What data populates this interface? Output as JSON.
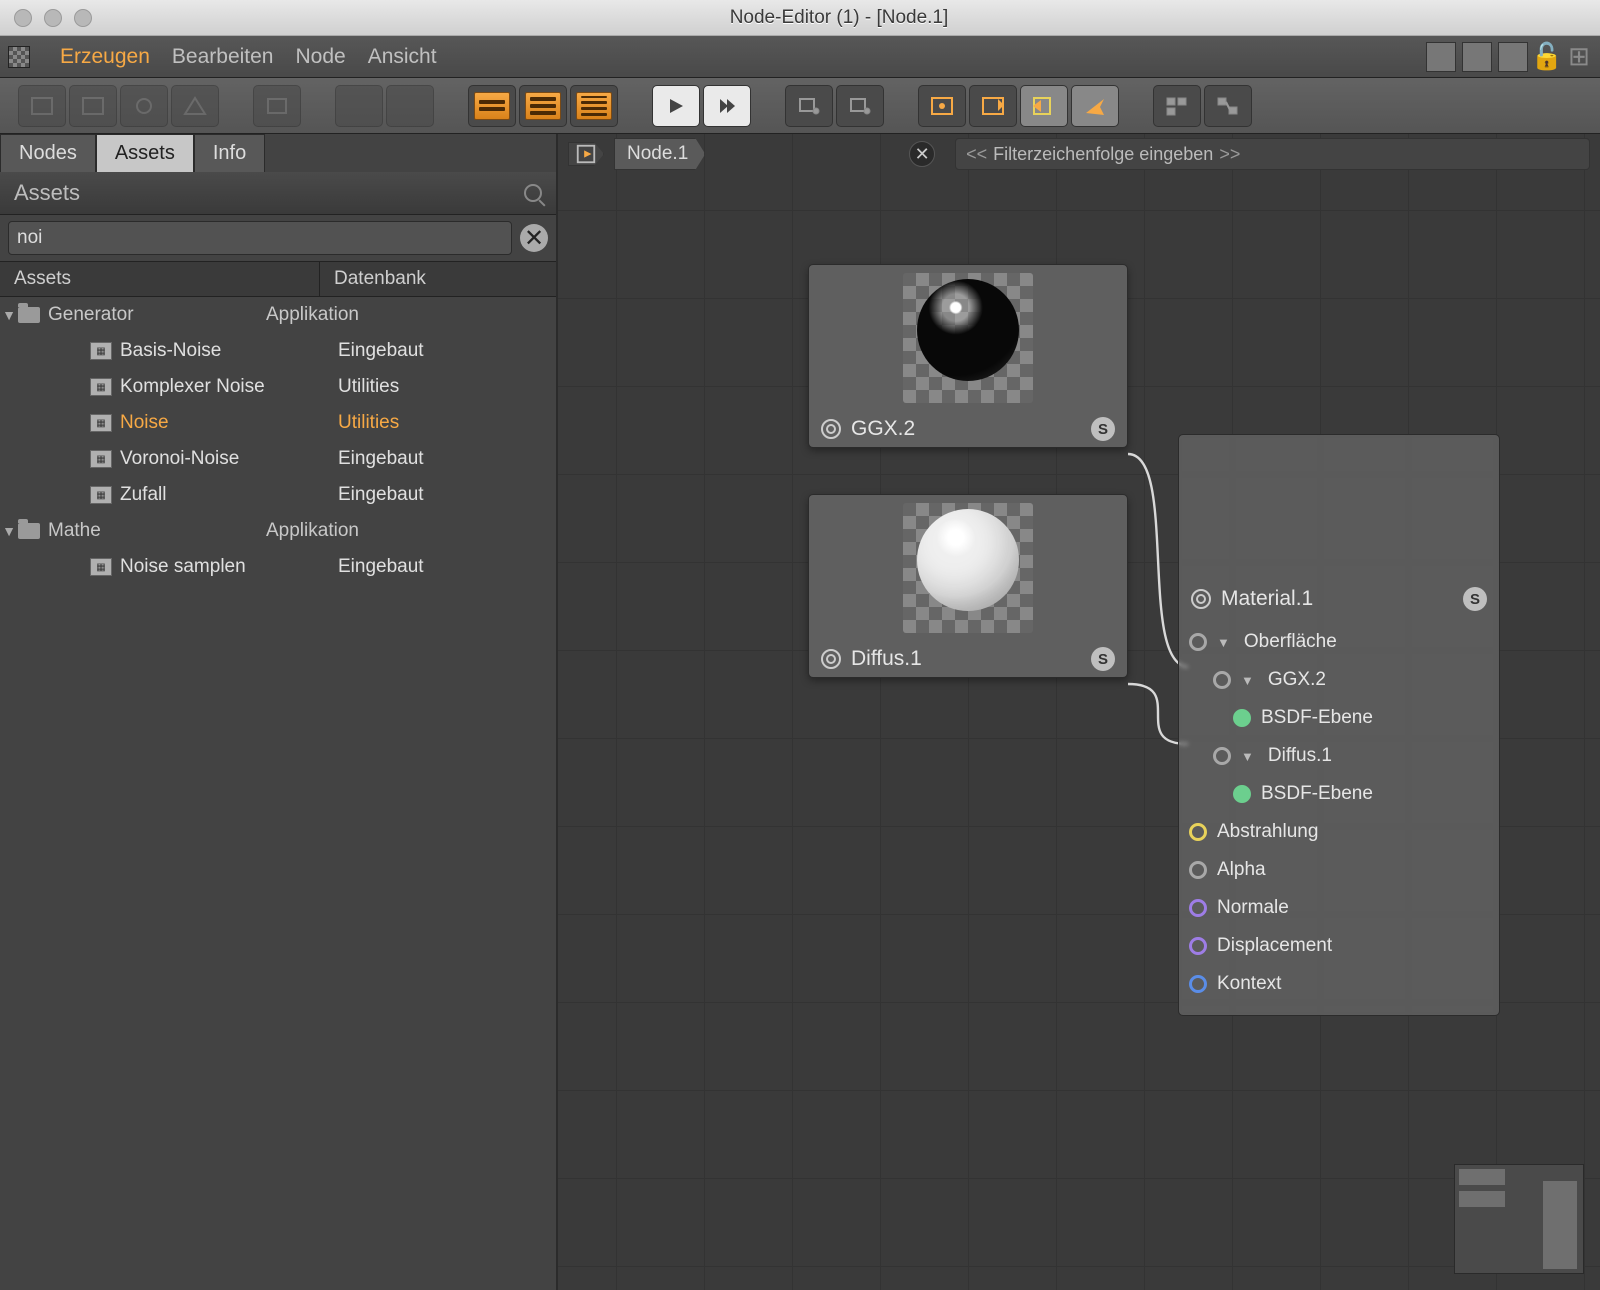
{
  "window": {
    "title": "Node-Editor (1) - [Node.1]"
  },
  "menu": {
    "erzeugen": "Erzeugen",
    "bearbeiten": "Bearbeiten",
    "node": "Node",
    "ansicht": "Ansicht"
  },
  "tabs": {
    "nodes": "Nodes",
    "assets": "Assets",
    "info": "Info"
  },
  "panel": {
    "title": "Assets",
    "search": "noi"
  },
  "list": {
    "hdr": {
      "assets": "Assets",
      "db": "Datenbank"
    },
    "rows": [
      {
        "type": "folder",
        "label": "Generator",
        "db": "Applikation"
      },
      {
        "type": "item",
        "label": "Basis-Noise",
        "db": "Eingebaut"
      },
      {
        "type": "item",
        "label": "Komplexer Noise",
        "db": "Utilities"
      },
      {
        "type": "item",
        "label": "Noise",
        "db": "Utilities",
        "selected": true
      },
      {
        "type": "item",
        "label": "Voronoi-Noise",
        "db": "Eingebaut"
      },
      {
        "type": "item",
        "label": "Zufall",
        "db": "Eingebaut"
      },
      {
        "type": "folder",
        "label": "Mathe",
        "db": "Applikation"
      },
      {
        "type": "item",
        "label": "Noise samplen",
        "db": "Eingebaut"
      }
    ]
  },
  "canvas": {
    "crumb": "Node.1",
    "filter": "Filterzeichenfolge eingeben",
    "ggx": "GGX.2",
    "diffus": "Diffus.1",
    "material": {
      "title": "Material.1",
      "oberflache": "Oberfläche",
      "ggx": "GGX.2",
      "bsdf": "BSDF-Ebene",
      "diffus": "Diffus.1",
      "abstrahlung": "Abstrahlung",
      "alpha": "Alpha",
      "normale": "Normale",
      "displacement": "Displacement",
      "kontext": "Kontext"
    }
  }
}
